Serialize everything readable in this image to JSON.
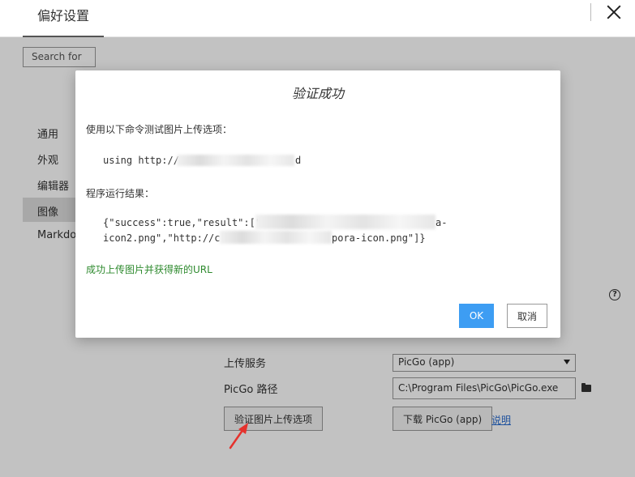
{
  "window": {
    "title": "偏好设置",
    "search_placeholder": "Search for"
  },
  "sidebar": {
    "items": [
      {
        "label": "通用",
        "active": false
      },
      {
        "label": "外观",
        "active": false
      },
      {
        "label": "编辑器",
        "active": false
      },
      {
        "label": "图像",
        "active": true
      },
      {
        "label": "Markdown",
        "active": false
      }
    ]
  },
  "image_settings": {
    "upload_service_label": "上传服务",
    "upload_service_value": "PicGo (app)",
    "picgo_path_label": "PicGo 路径",
    "picgo_path_value": "C:\\Program Files\\PicGo\\PicGo.exe",
    "verify_button": "验证图片上传选项",
    "download_button": "下载 PicGo (app)",
    "help_link": "说明"
  },
  "dialog": {
    "title": "验证成功",
    "command_label": "使用以下命令测试图片上传选项：",
    "command_prefix": "using http://",
    "command_suffix": "d",
    "result_label": "程序运行结果：",
    "result_line1_prefix": "{\"success\":true,\"result\":[\"",
    "result_line1_suffix": "a-",
    "result_line2_prefix": "icon2.png\",\"http://c",
    "result_line2_suffix": "pora-icon.png\"]}",
    "success_message": "成功上传图片并获得新的URL",
    "ok_button": "OK",
    "cancel_button": "取消"
  },
  "colors": {
    "accent": "#3d9df3",
    "success": "#2e8a2e",
    "link": "#2a6ccf",
    "annotation_arrow": "#e5322d"
  },
  "icons": {
    "close": "close-icon",
    "help": "question-circle-icon",
    "folder": "folder-icon",
    "dropdown": "caret-down-icon"
  }
}
